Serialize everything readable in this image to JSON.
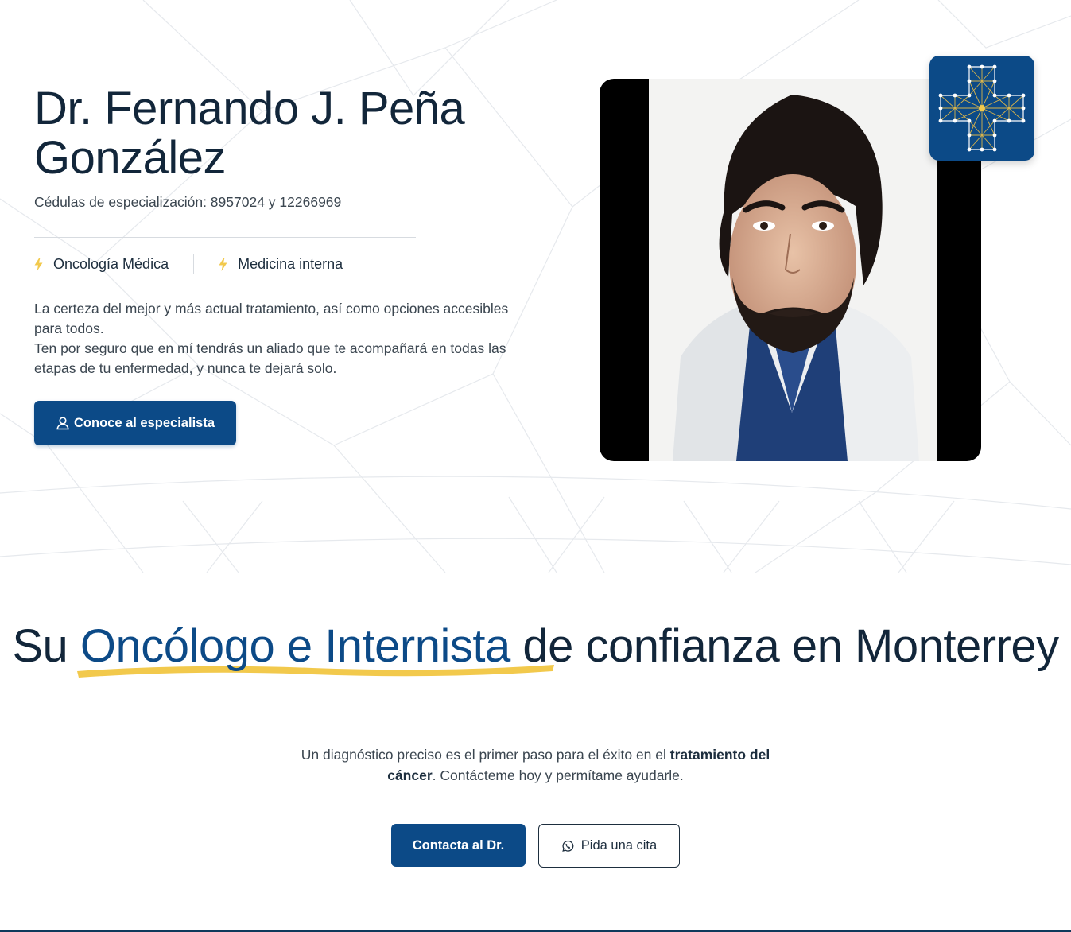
{
  "hero": {
    "title": "Dr. Fernando J. Peña González",
    "cedulas": "Cédulas de especialización: 8957024 y 12266969",
    "specialties": [
      {
        "label": "Oncología Médica",
        "icon": "bolt-icon"
      },
      {
        "label": "Medicina interna",
        "icon": "bolt-icon"
      }
    ],
    "description_line1": "La certeza del mejor y más actual tratamiento, así como opciones accesibles para todos.",
    "description_line2": "Ten por seguro que en mí tendrás un aliado que te acompañará en todas las etapas de tu enfermedad, y nunca te dejará solo.",
    "cta_label": "Conoce al especialista",
    "cta_icon": "user-icon",
    "logo_icon": "medical-cross-network-icon"
  },
  "section2": {
    "title_prefix": "Su ",
    "title_highlight": "Oncólogo e Internista",
    "title_suffix": " de confianza en Monterrey",
    "desc_part1": "Un diagnóstico preciso es el primer paso para el éxito en el ",
    "desc_bold": "tratamiento del cáncer",
    "desc_part2": ". Contácteme hoy y permítame ayudarle.",
    "contact_label": "Contacta al Dr.",
    "appointment_label": "Pida una cita",
    "appointment_icon": "whatsapp-icon"
  },
  "colors": {
    "primary": "#0c4a87",
    "heading": "#12263a",
    "accent_yellow": "#f2c94c",
    "text": "#3b4650"
  }
}
